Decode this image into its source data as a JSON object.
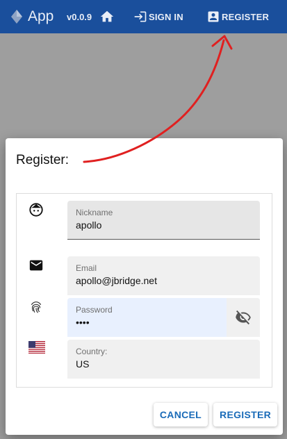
{
  "appbar": {
    "title": "App",
    "version": "v0.0.9",
    "signin_label": "SIGN IN",
    "register_label": "REGISTER",
    "bg_color": "#1a4f9c"
  },
  "dialog": {
    "title": "Register:",
    "fields": {
      "nickname": {
        "label": "Nickname",
        "value": "apollo",
        "icon": "face-icon"
      },
      "email": {
        "label": "Email",
        "value": "apollo@jbridge.net",
        "icon": "mail-icon"
      },
      "password": {
        "label": "Password",
        "value": "••••",
        "icon": "fingerprint-icon",
        "toggle_icon": "eye-off-icon"
      },
      "country": {
        "label": "Country:",
        "value": "US",
        "icon": "us-flag-icon"
      }
    },
    "actions": {
      "cancel_label": "CANCEL",
      "register_label": "REGISTER"
    }
  },
  "annotation": {
    "color": "#e02020"
  }
}
